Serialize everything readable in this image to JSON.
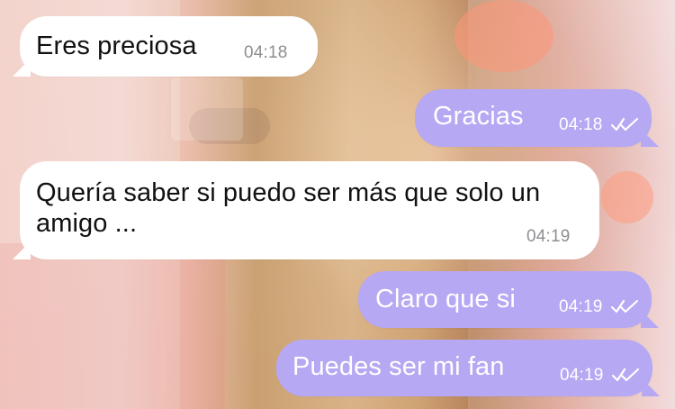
{
  "chat": {
    "messages": [
      {
        "text": "Eres preciosa",
        "time": "04:18",
        "direction": "incoming"
      },
      {
        "text": "Gracias",
        "time": "04:18",
        "direction": "outgoing",
        "status_icon": "double-check-icon"
      },
      {
        "text": "Quería saber si puedo ser más que solo un amigo ...",
        "time": "04:19",
        "direction": "incoming"
      },
      {
        "text": "Claro que si",
        "time": "04:19",
        "direction": "outgoing",
        "status_icon": "double-check-icon"
      },
      {
        "text": "Puedes ser mi fan",
        "time": "04:19",
        "direction": "outgoing",
        "status_icon": "double-check-icon"
      }
    ],
    "colors": {
      "incoming_bubble": "#ffffff",
      "outgoing_bubble": "#b6a8f3",
      "incoming_text": "#111111",
      "outgoing_text": "#ffffff",
      "timestamp_incoming": "#8e8e93"
    }
  }
}
